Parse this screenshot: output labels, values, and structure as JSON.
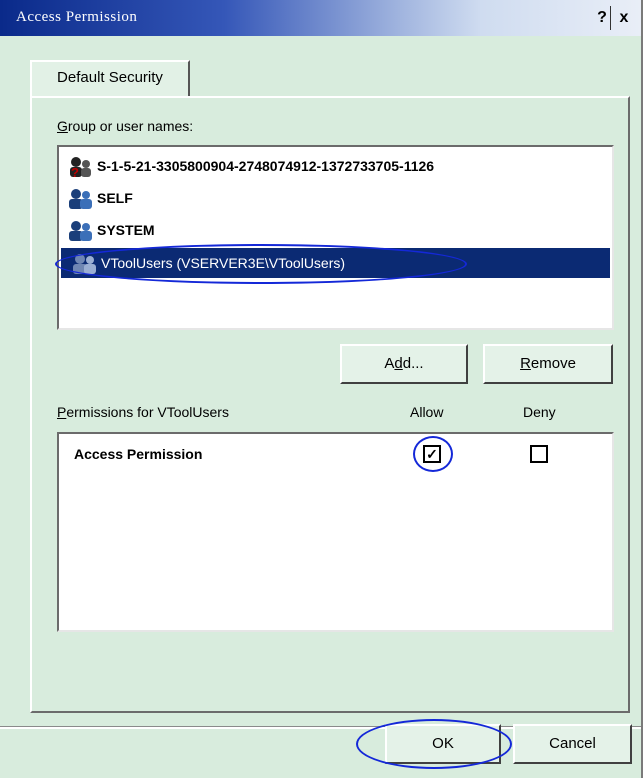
{
  "window": {
    "title": "Access Permission",
    "help_label": "?",
    "close_label": "x"
  },
  "tabs": [
    {
      "label": "Default Security"
    }
  ],
  "group_section": {
    "label_prefix": "",
    "label_accel": "G",
    "label_rest": "roup or user names:",
    "items": [
      {
        "label": "S-1-5-21-3305800904-2748074912-1372733705-1126",
        "icon": "unknown-user-icon",
        "selected": false
      },
      {
        "label": "SELF",
        "icon": "users-icon",
        "selected": false
      },
      {
        "label": "SYSTEM",
        "icon": "users-icon",
        "selected": false
      },
      {
        "label": "VToolUsers (VSERVER3E\\VToolUsers)",
        "icon": "users-icon",
        "selected": true
      }
    ]
  },
  "buttons": {
    "add_label_pre": "A",
    "add_accel": "d",
    "add_label_post": "d...",
    "remove_accel": "R",
    "remove_label_post": "emove",
    "ok_label": "OK",
    "cancel_label": "Cancel"
  },
  "permissions": {
    "label_accel": "P",
    "label_rest": "ermissions for VToolUsers",
    "allow_header": "Allow",
    "deny_header": "Deny",
    "rows": [
      {
        "name": "Access Permission",
        "allow": true,
        "deny": false
      }
    ]
  },
  "colors": {
    "dialog_bg": "#d8ecdd",
    "selection": "#0b2a73",
    "annotation": "#1428d8"
  }
}
